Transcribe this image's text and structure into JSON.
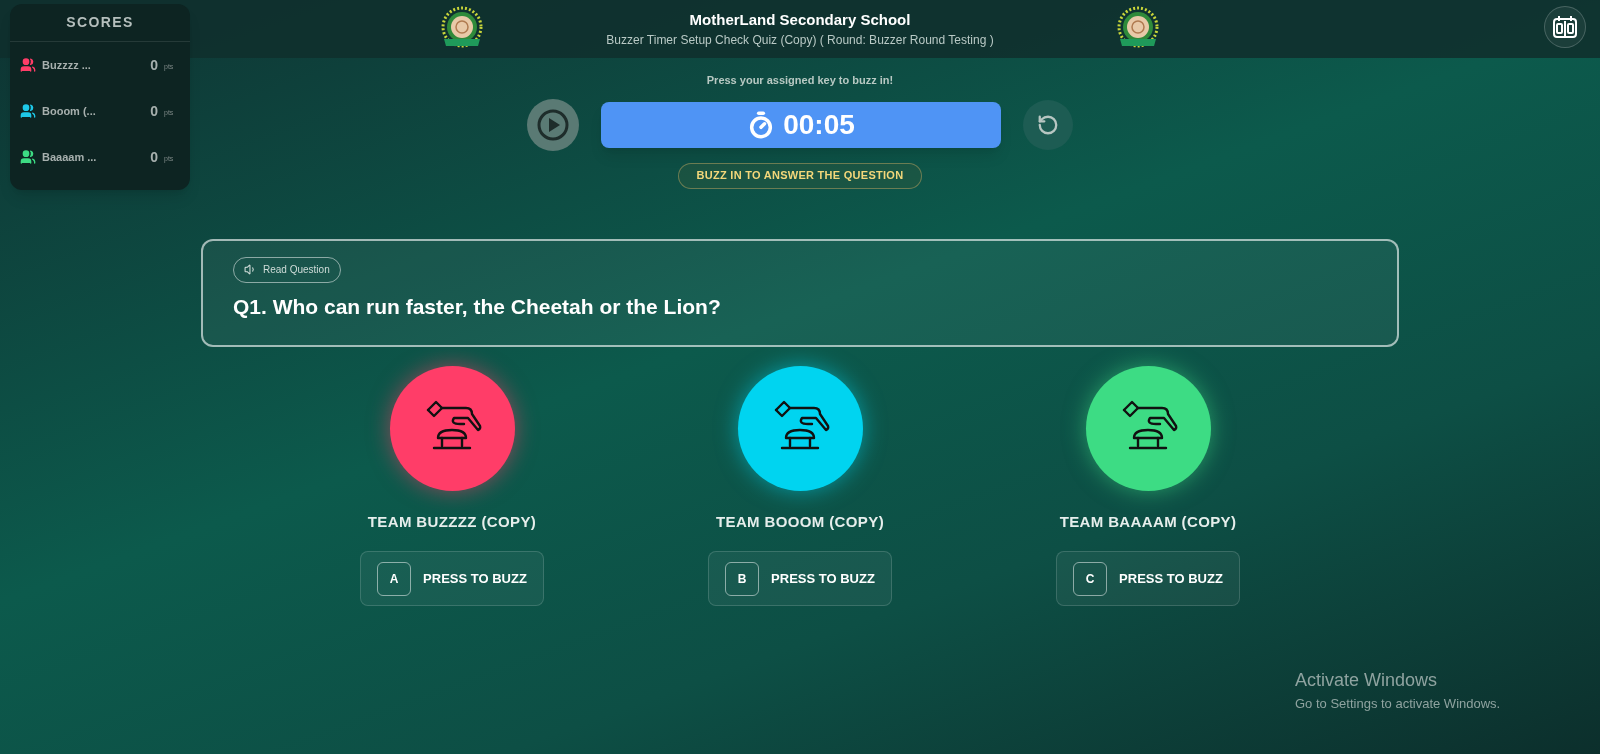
{
  "header": {
    "title": "MotherLand Secondary School",
    "subtitle": "Buzzer Timer Setup Check Quiz (Copy) ( Round: Buzzer Round Testing )"
  },
  "scores": {
    "title": "SCORES",
    "teams": [
      {
        "name": "Buzzzz ...",
        "points": "0",
        "unit": "pts",
        "color": "#ff3d68"
      },
      {
        "name": "Booom (...",
        "points": "0",
        "unit": "pts",
        "color": "#1ec8e8"
      },
      {
        "name": "Baaaam ...",
        "points": "0",
        "unit": "pts",
        "color": "#3ddc84"
      }
    ]
  },
  "timer": {
    "hint": "Press your assigned key to buzz in!",
    "time": "00:05",
    "status": "BUZZ IN TO ANSWER THE QUESTION"
  },
  "question": {
    "read_button": "Read Question",
    "text": "Q1. Who can run faster, the Cheetah or the Lion?"
  },
  "teams": [
    {
      "name": "TEAM BUZZZZ (COPY)",
      "key": "A",
      "button": "PRESS TO BUZZ",
      "color": "#ff3d68"
    },
    {
      "name": "TEAM BOOOM (COPY)",
      "key": "B",
      "button": "PRESS TO BUZZ",
      "color": "#00d4f0"
    },
    {
      "name": "TEAM BAAAAM (COPY)",
      "key": "C",
      "button": "PRESS TO BUZZ",
      "color": "#3ddc84"
    }
  ],
  "os_notice": {
    "title": "Activate Windows",
    "text": "Go to Settings to activate Windows."
  }
}
